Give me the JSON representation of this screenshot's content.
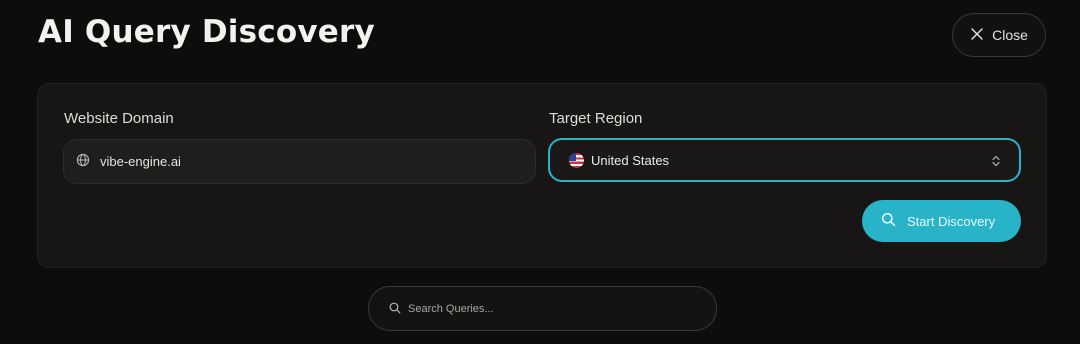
{
  "header": {
    "title": "AI Query Discovery",
    "close_label": "Close"
  },
  "form": {
    "domain_label": "Website Domain",
    "domain_value": "vibe-engine.ai",
    "region_label": "Target Region",
    "region_value": "United States",
    "region_flag": "us-flag-icon",
    "start_label": "Start Discovery"
  },
  "search": {
    "placeholder": "Search Queries..."
  },
  "colors": {
    "background": "#0e0d0c",
    "panel": "#171615",
    "accent": "#28b3c9"
  }
}
